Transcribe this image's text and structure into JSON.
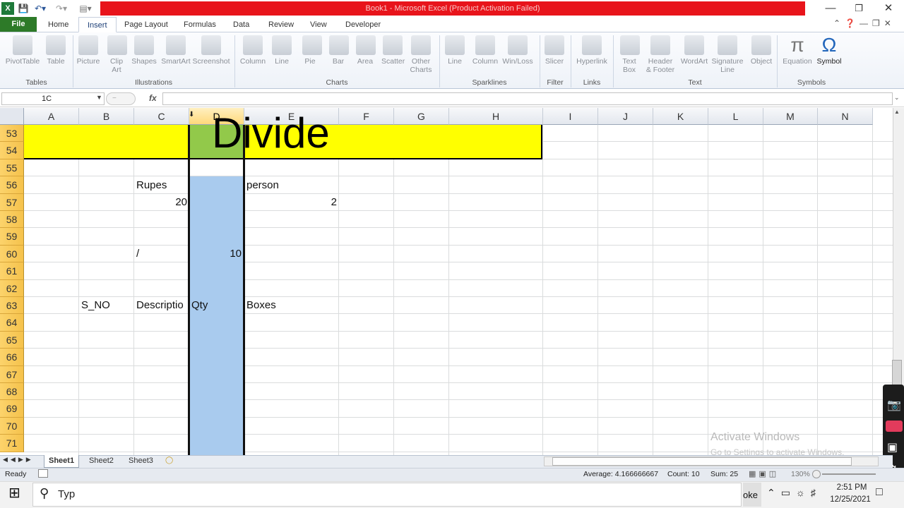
{
  "titlebar": {
    "title": "Book1 - Microsoft Excel (Product Activation Failed)"
  },
  "tabs": [
    "File",
    "Home",
    "Insert",
    "Page Layout",
    "Formulas",
    "Data",
    "Review",
    "View",
    "Developer"
  ],
  "ribbon": {
    "buttons": [
      {
        "id": "pivottable",
        "label": "PivotTable"
      },
      {
        "id": "table",
        "label": "Table"
      },
      {
        "id": "picture",
        "label": "Picture"
      },
      {
        "id": "clipart",
        "label": "Clip Art"
      },
      {
        "id": "shapes",
        "label": "Shapes"
      },
      {
        "id": "smartart",
        "label": "SmartArt"
      },
      {
        "id": "screenshot",
        "label": "Screenshot"
      },
      {
        "id": "column",
        "label": "Column"
      },
      {
        "id": "line",
        "label": "Line"
      },
      {
        "id": "pie",
        "label": "Pie"
      },
      {
        "id": "bar",
        "label": "Bar"
      },
      {
        "id": "area",
        "label": "Area"
      },
      {
        "id": "scatter",
        "label": "Scatter"
      },
      {
        "id": "othercharts",
        "label": "Other Charts"
      },
      {
        "id": "spark-line",
        "label": "Line"
      },
      {
        "id": "spark-column",
        "label": "Column"
      },
      {
        "id": "winloss",
        "label": "Win/Loss"
      },
      {
        "id": "slicer",
        "label": "Slicer"
      },
      {
        "id": "hyperlink",
        "label": "Hyperlink"
      },
      {
        "id": "textbox",
        "label": "Text Box"
      },
      {
        "id": "headerfooter",
        "label": "Header & Footer"
      },
      {
        "id": "wordart",
        "label": "WordArt"
      },
      {
        "id": "signatureline",
        "label": "Signature Line"
      },
      {
        "id": "object",
        "label": "Object"
      },
      {
        "id": "equation",
        "label": "Equation"
      },
      {
        "id": "symbol",
        "label": "Symbol"
      }
    ],
    "groups": [
      "Tables",
      "Illustrations",
      "Charts",
      "Sparklines",
      "Filter",
      "Links",
      "Text",
      "Symbols"
    ]
  },
  "formula_bar": {
    "name_box": "1C",
    "fx": "fx",
    "content": ""
  },
  "columns": [
    "A",
    "B",
    "C",
    "D",
    "E",
    "F",
    "G",
    "H",
    "I",
    "J",
    "K",
    "L",
    "M",
    "N"
  ],
  "rows": [
    "53",
    "54",
    "55",
    "56",
    "57",
    "58",
    "59",
    "60",
    "61",
    "62",
    "63",
    "64",
    "65",
    "66",
    "67",
    "68",
    "69",
    "70",
    "71"
  ],
  "cells": {
    "banner": "Divide",
    "c56": "Rupes",
    "e56": "person",
    "c57": "20",
    "e57": "2",
    "c60": "/",
    "d60": "10",
    "b63": "S_NO",
    "c63": "Descriptio",
    "d63": "Qty",
    "e63": "Boxes"
  },
  "watermark": {
    "line1": "Activate Windows",
    "line2": "Go to Settings to activate Windows."
  },
  "sheets": [
    "Sheet1",
    "Sheet2",
    "Sheet3"
  ],
  "status": {
    "ready": "Ready",
    "average": "Average: 4.166666667",
    "count": "Count: 10",
    "sum": "Sum: 25",
    "zoom": "130%"
  },
  "taskbar": {
    "search": "Typ",
    "app_fragment": "oke",
    "time": "2:51 PM",
    "date": "12/25/2021"
  },
  "colors": {
    "banner_yellow": "#ffff00",
    "banner_green": "#92c94a",
    "col_d_fill": "#a9cbee",
    "row_header": "#f5c24c",
    "title_red": "#e8141b",
    "file_green": "#2d7a28"
  }
}
